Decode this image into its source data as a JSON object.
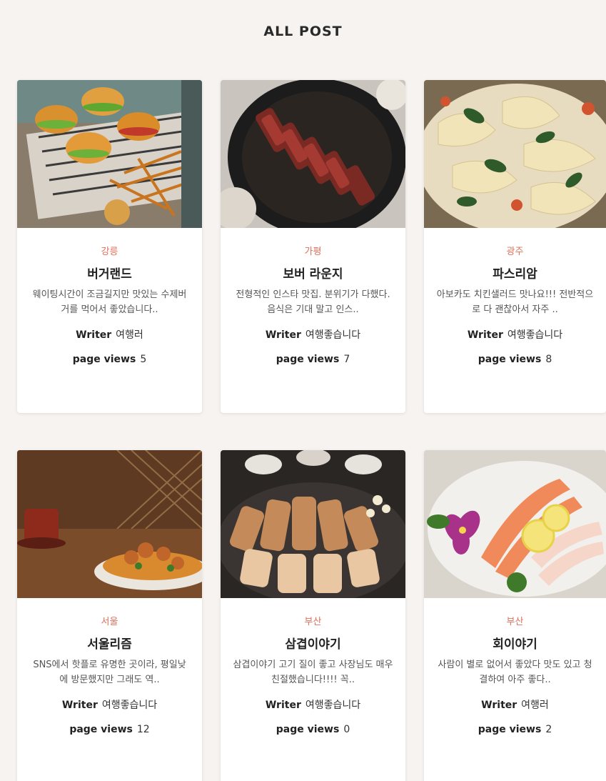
{
  "page_title": "ALL POST",
  "writer_label": "Writer",
  "views_label": "page views",
  "posts": [
    {
      "region": "강릉",
      "title": "버거랜드",
      "desc": "웨이팅시간이 조금길지만 맛있는 수제버거를 먹어서 좋았습니다..",
      "writer": "여행러",
      "views": "5",
      "image": "burger-photo"
    },
    {
      "region": "가평",
      "title": "보버 라운지",
      "desc": "전형적인 인스타 맛집. 분위기가 다했다. 음식은 기대 말고 인스..",
      "writer": "여행좋습니다",
      "views": "7",
      "image": "steak-photo"
    },
    {
      "region": "광주",
      "title": "파스리암",
      "desc": "아보카도 치킨샐러드 맛나요!!! 전반적으로 다 괜찮아서 자주 ..",
      "writer": "여행좋습니다",
      "views": "8",
      "image": "pasta-photo"
    },
    {
      "region": "서울",
      "title": "서울리즘",
      "desc": "SNS에서 핫플로 유명한 곳이라, 평일낮에 방문했지만 그래도 역..",
      "writer": "여행좋습니다",
      "views": "12",
      "image": "cafe-dish-photo"
    },
    {
      "region": "부산",
      "title": "삼겹이야기",
      "desc": "삼겹이야기 고기 질이 좋고 사장님도 매우 친절했습니다!!!! 꼭..",
      "writer": "여행좋습니다",
      "views": "0",
      "image": "pork-belly-photo"
    },
    {
      "region": "부산",
      "title": "회이야기",
      "desc": "사람이 별로 없어서 좋았다 맛도 있고 청결하여 아주 좋다..",
      "writer": "여행러",
      "views": "2",
      "image": "sashimi-photo"
    }
  ]
}
